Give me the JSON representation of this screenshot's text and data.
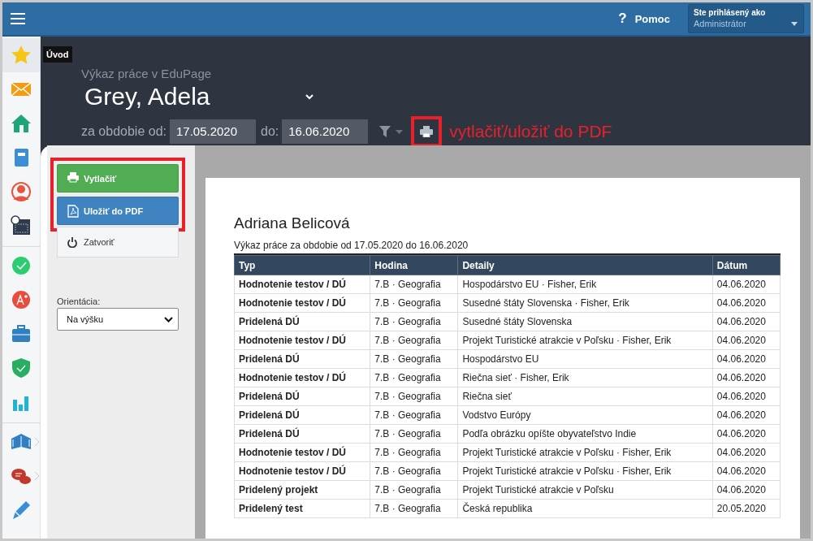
{
  "topbar": {
    "help": {
      "icon": "?",
      "label": "Pomoc"
    },
    "user": {
      "caption": "Ste prihlásený ako",
      "role": "Administrátor"
    }
  },
  "sidebar": {
    "tooltip": "Úvod",
    "groups": [
      [
        {
          "kind": "star",
          "selected": true
        },
        {
          "kind": "mail",
          "selected": false
        },
        {
          "kind": "home",
          "selected": false
        },
        {
          "kind": "notebook",
          "selected": false
        },
        {
          "kind": "person",
          "selected": false
        },
        {
          "kind": "calendar",
          "selected": false
        }
      ],
      [
        {
          "kind": "check",
          "selected": false
        },
        {
          "kind": "grade",
          "selected": false
        },
        {
          "kind": "briefcase",
          "selected": false
        },
        {
          "kind": "shield",
          "selected": false
        },
        {
          "kind": "chart",
          "selected": false
        }
      ],
      [
        {
          "kind": "book",
          "selected": false,
          "submenu": true
        },
        {
          "kind": "chat",
          "selected": false,
          "submenu": true
        },
        {
          "kind": "pen",
          "selected": false
        }
      ]
    ]
  },
  "header": {
    "subtitle": "Výkaz práce v EduPage",
    "person": "Grey, Adela",
    "from_label": "za obdobie od:",
    "from": "17.05.2020",
    "to_label": "do:",
    "to": "16.06.2020",
    "print_highlighted": true,
    "annotation": "vytlačiť/uložiť do PDF"
  },
  "print_panel": {
    "highlighted": true,
    "buttons": [
      {
        "kind": "print",
        "label": "Vytlačiť"
      },
      {
        "kind": "pdf",
        "label": "Uložiť do PDF"
      }
    ],
    "close": "Zatvoriť",
    "orientation_label": "Orientácia:",
    "orientation": "Na výšku"
  },
  "report": {
    "title": "Adriana Belicová",
    "subtitle": "Výkaz práce za obdobie od 17.05.2020 do 16.06.2020",
    "columns": [
      "Typ",
      "Hodina",
      "Detaily",
      "Dátum"
    ],
    "rows": [
      [
        "Hodnotenie testov / DÚ",
        "7.B · Geografia",
        "Hospodárstvo EU · Fisher, Erik",
        "04.06.2020"
      ],
      [
        "Hodnotenie testov / DÚ",
        "7.B · Geografia",
        "Susedné štáty Slovenska · Fisher, Erik",
        "04.06.2020"
      ],
      [
        "Pridelená DÚ",
        "7.B · Geografia",
        "Susedné štáty Slovenska",
        "04.06.2020"
      ],
      [
        "Hodnotenie testov / DÚ",
        "7.B · Geografia",
        "Projekt Turistické atrakcie v Poľsku · Fisher, Erik",
        "04.06.2020"
      ],
      [
        "Pridelená DÚ",
        "7.B · Geografia",
        "Hospodárstvo EU",
        "04.06.2020"
      ],
      [
        "Hodnotenie testov / DÚ",
        "7.B · Geografia",
        "Riečna sieť · Fisher, Erik",
        "04.06.2020"
      ],
      [
        "Pridelená DÚ",
        "7.B · Geografia",
        "Riečna sieť",
        "04.06.2020"
      ],
      [
        "Pridelená DÚ",
        "7.B · Geografia",
        "Vodstvo Európy",
        "04.06.2020"
      ],
      [
        "Pridelená DÚ",
        "7.B · Geografia",
        "Podľa obrázku opíšte obyvateľstvo Indie",
        "04.06.2020"
      ],
      [
        "Hodnotenie testov / DÚ",
        "7.B · Geografia",
        "Projekt Turistické atrakcie v Poľsku · Fisher, Erik",
        "04.06.2020"
      ],
      [
        "Hodnotenie testov / DÚ",
        "7.B · Geografia",
        "Projekt Turistické atrakcie v Poľsku · Fisher, Erik",
        "04.06.2020"
      ],
      [
        "Pridelený projekt",
        "7.B · Geografia",
        "Projekt Turistické atrakcie v Poľsku",
        "04.06.2020"
      ],
      [
        "Pridelený test",
        "7.B · Geografia",
        "Česká republika",
        "20.05.2020"
      ]
    ]
  }
}
